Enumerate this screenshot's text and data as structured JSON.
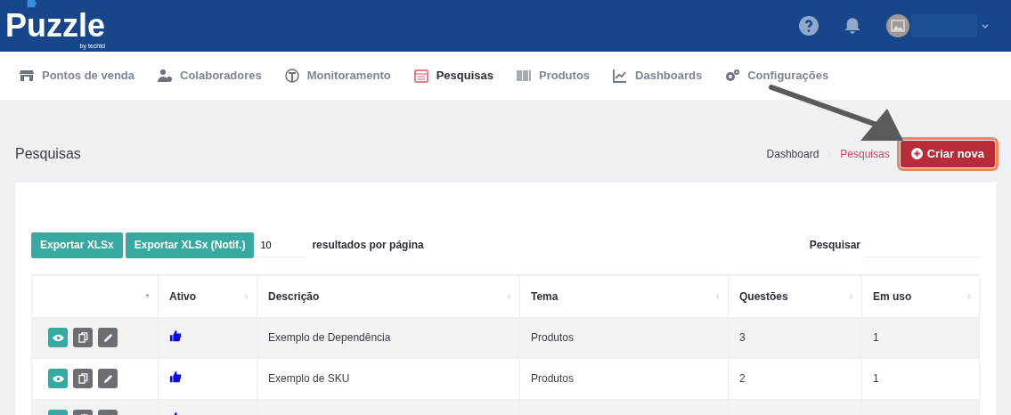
{
  "header": {
    "logo": "Puzzle",
    "logo_tagline": "by techtd"
  },
  "nav": [
    {
      "label": "Pontos de venda",
      "selected": false
    },
    {
      "label": "Colaboradores",
      "selected": false
    },
    {
      "label": "Monitoramento",
      "selected": false
    },
    {
      "label": "Pesquisas",
      "selected": true
    },
    {
      "label": "Produtos",
      "selected": false
    },
    {
      "label": "Dashboards",
      "selected": false
    },
    {
      "label": "Configurações",
      "selected": false
    }
  ],
  "page_title": "Pesquisas",
  "breadcrumb": [
    {
      "label": "Dashboard",
      "selected": false
    },
    {
      "label": "Pesquisas",
      "selected": true
    }
  ],
  "create_button": {
    "label": "Criar nova",
    "highlighted": true
  },
  "toolbar": {
    "buttons": [
      "Exportar XLSx",
      "Exportar XLSx (Notif.)"
    ],
    "page_size": "10",
    "page_size_label": "resultados por página",
    "search_label": "Pesquisar"
  },
  "table": {
    "columns": [
      "",
      "Ativo",
      "Descrição",
      "Tema",
      "Questões",
      "Em uso"
    ],
    "rows": [
      {
        "active": true,
        "description": "Exemplo de Dependência",
        "theme": "Produtos",
        "questions": "3",
        "in_use": "1"
      },
      {
        "active": true,
        "description": "Exemplo de SKU",
        "theme": "Produtos",
        "questions": "2",
        "in_use": "1"
      },
      {
        "active": true
      }
    ]
  }
}
